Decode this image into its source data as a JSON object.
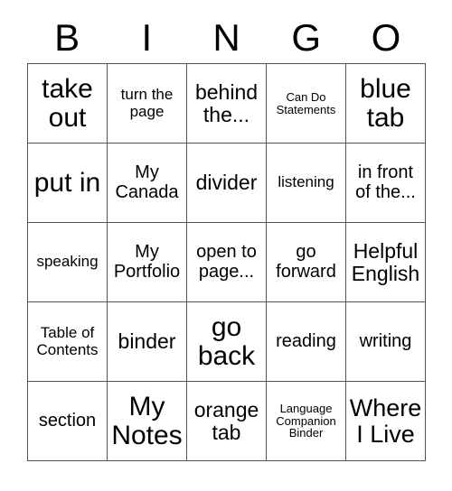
{
  "card": {
    "header_letters": [
      "B",
      "I",
      "N",
      "G",
      "O"
    ],
    "rows": [
      [
        {
          "text": "take out",
          "size": "fs-xxl"
        },
        {
          "text": "turn the page",
          "size": "fs-s"
        },
        {
          "text": "behind the...",
          "size": "fs-l"
        },
        {
          "text": "Can Do Statements",
          "size": "fs-xs"
        },
        {
          "text": "blue tab",
          "size": "fs-xxl"
        }
      ],
      [
        {
          "text": "put in",
          "size": "fs-xxl"
        },
        {
          "text": "My Canada",
          "size": "fs-m"
        },
        {
          "text": "divider",
          "size": "fs-l"
        },
        {
          "text": "listening",
          "size": "fs-s"
        },
        {
          "text": "in front of the...",
          "size": "fs-m"
        }
      ],
      [
        {
          "text": "speaking",
          "size": "fs-s"
        },
        {
          "text": "My Portfolio",
          "size": "fs-m"
        },
        {
          "text": "open to page...",
          "size": "fs-m"
        },
        {
          "text": "go forward",
          "size": "fs-m"
        },
        {
          "text": "Helpful English",
          "size": "fs-l"
        }
      ],
      [
        {
          "text": "Table of Contents",
          "size": "fs-s"
        },
        {
          "text": "binder",
          "size": "fs-l"
        },
        {
          "text": "go back",
          "size": "fs-xxl"
        },
        {
          "text": "reading",
          "size": "fs-m"
        },
        {
          "text": "writing",
          "size": "fs-m"
        }
      ],
      [
        {
          "text": "section",
          "size": "fs-m"
        },
        {
          "text": "My Notes",
          "size": "fs-xxl"
        },
        {
          "text": "orange tab",
          "size": "fs-l"
        },
        {
          "text": "Language Companion Binder",
          "size": "fs-xs"
        },
        {
          "text": "Where I Live",
          "size": "fs-xl"
        }
      ]
    ],
    "colors": {
      "background": "#ffffff",
      "border": "#555555",
      "text": "#000000"
    }
  }
}
